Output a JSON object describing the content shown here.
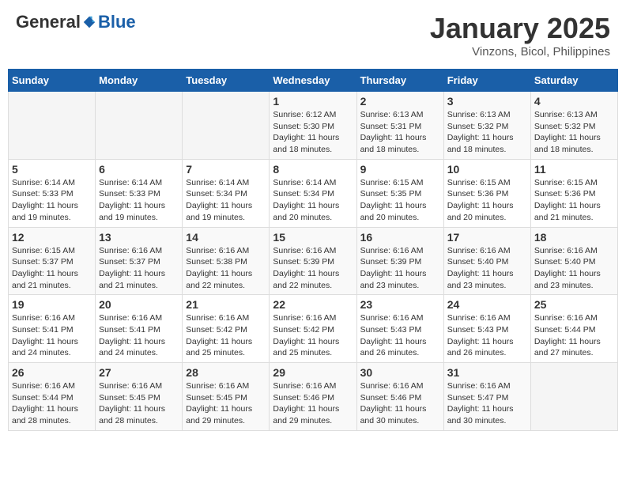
{
  "header": {
    "logo": {
      "general": "General",
      "blue": "Blue"
    },
    "title": "January 2025",
    "subtitle": "Vinzons, Bicol, Philippines"
  },
  "weekdays": [
    "Sunday",
    "Monday",
    "Tuesday",
    "Wednesday",
    "Thursday",
    "Friday",
    "Saturday"
  ],
  "weeks": [
    [
      {
        "day": "",
        "sunrise": "",
        "sunset": "",
        "daylight": "",
        "empty": true
      },
      {
        "day": "",
        "sunrise": "",
        "sunset": "",
        "daylight": "",
        "empty": true
      },
      {
        "day": "",
        "sunrise": "",
        "sunset": "",
        "daylight": "",
        "empty": true
      },
      {
        "day": "1",
        "sunrise": "Sunrise: 6:12 AM",
        "sunset": "Sunset: 5:30 PM",
        "daylight": "Daylight: 11 hours and 18 minutes.",
        "empty": false
      },
      {
        "day": "2",
        "sunrise": "Sunrise: 6:13 AM",
        "sunset": "Sunset: 5:31 PM",
        "daylight": "Daylight: 11 hours and 18 minutes.",
        "empty": false
      },
      {
        "day": "3",
        "sunrise": "Sunrise: 6:13 AM",
        "sunset": "Sunset: 5:32 PM",
        "daylight": "Daylight: 11 hours and 18 minutes.",
        "empty": false
      },
      {
        "day": "4",
        "sunrise": "Sunrise: 6:13 AM",
        "sunset": "Sunset: 5:32 PM",
        "daylight": "Daylight: 11 hours and 18 minutes.",
        "empty": false
      }
    ],
    [
      {
        "day": "5",
        "sunrise": "Sunrise: 6:14 AM",
        "sunset": "Sunset: 5:33 PM",
        "daylight": "Daylight: 11 hours and 19 minutes.",
        "empty": false
      },
      {
        "day": "6",
        "sunrise": "Sunrise: 6:14 AM",
        "sunset": "Sunset: 5:33 PM",
        "daylight": "Daylight: 11 hours and 19 minutes.",
        "empty": false
      },
      {
        "day": "7",
        "sunrise": "Sunrise: 6:14 AM",
        "sunset": "Sunset: 5:34 PM",
        "daylight": "Daylight: 11 hours and 19 minutes.",
        "empty": false
      },
      {
        "day": "8",
        "sunrise": "Sunrise: 6:14 AM",
        "sunset": "Sunset: 5:34 PM",
        "daylight": "Daylight: 11 hours and 20 minutes.",
        "empty": false
      },
      {
        "day": "9",
        "sunrise": "Sunrise: 6:15 AM",
        "sunset": "Sunset: 5:35 PM",
        "daylight": "Daylight: 11 hours and 20 minutes.",
        "empty": false
      },
      {
        "day": "10",
        "sunrise": "Sunrise: 6:15 AM",
        "sunset": "Sunset: 5:36 PM",
        "daylight": "Daylight: 11 hours and 20 minutes.",
        "empty": false
      },
      {
        "day": "11",
        "sunrise": "Sunrise: 6:15 AM",
        "sunset": "Sunset: 5:36 PM",
        "daylight": "Daylight: 11 hours and 21 minutes.",
        "empty": false
      }
    ],
    [
      {
        "day": "12",
        "sunrise": "Sunrise: 6:15 AM",
        "sunset": "Sunset: 5:37 PM",
        "daylight": "Daylight: 11 hours and 21 minutes.",
        "empty": false
      },
      {
        "day": "13",
        "sunrise": "Sunrise: 6:16 AM",
        "sunset": "Sunset: 5:37 PM",
        "daylight": "Daylight: 11 hours and 21 minutes.",
        "empty": false
      },
      {
        "day": "14",
        "sunrise": "Sunrise: 6:16 AM",
        "sunset": "Sunset: 5:38 PM",
        "daylight": "Daylight: 11 hours and 22 minutes.",
        "empty": false
      },
      {
        "day": "15",
        "sunrise": "Sunrise: 6:16 AM",
        "sunset": "Sunset: 5:39 PM",
        "daylight": "Daylight: 11 hours and 22 minutes.",
        "empty": false
      },
      {
        "day": "16",
        "sunrise": "Sunrise: 6:16 AM",
        "sunset": "Sunset: 5:39 PM",
        "daylight": "Daylight: 11 hours and 23 minutes.",
        "empty": false
      },
      {
        "day": "17",
        "sunrise": "Sunrise: 6:16 AM",
        "sunset": "Sunset: 5:40 PM",
        "daylight": "Daylight: 11 hours and 23 minutes.",
        "empty": false
      },
      {
        "day": "18",
        "sunrise": "Sunrise: 6:16 AM",
        "sunset": "Sunset: 5:40 PM",
        "daylight": "Daylight: 11 hours and 23 minutes.",
        "empty": false
      }
    ],
    [
      {
        "day": "19",
        "sunrise": "Sunrise: 6:16 AM",
        "sunset": "Sunset: 5:41 PM",
        "daylight": "Daylight: 11 hours and 24 minutes.",
        "empty": false
      },
      {
        "day": "20",
        "sunrise": "Sunrise: 6:16 AM",
        "sunset": "Sunset: 5:41 PM",
        "daylight": "Daylight: 11 hours and 24 minutes.",
        "empty": false
      },
      {
        "day": "21",
        "sunrise": "Sunrise: 6:16 AM",
        "sunset": "Sunset: 5:42 PM",
        "daylight": "Daylight: 11 hours and 25 minutes.",
        "empty": false
      },
      {
        "day": "22",
        "sunrise": "Sunrise: 6:16 AM",
        "sunset": "Sunset: 5:42 PM",
        "daylight": "Daylight: 11 hours and 25 minutes.",
        "empty": false
      },
      {
        "day": "23",
        "sunrise": "Sunrise: 6:16 AM",
        "sunset": "Sunset: 5:43 PM",
        "daylight": "Daylight: 11 hours and 26 minutes.",
        "empty": false
      },
      {
        "day": "24",
        "sunrise": "Sunrise: 6:16 AM",
        "sunset": "Sunset: 5:43 PM",
        "daylight": "Daylight: 11 hours and 26 minutes.",
        "empty": false
      },
      {
        "day": "25",
        "sunrise": "Sunrise: 6:16 AM",
        "sunset": "Sunset: 5:44 PM",
        "daylight": "Daylight: 11 hours and 27 minutes.",
        "empty": false
      }
    ],
    [
      {
        "day": "26",
        "sunrise": "Sunrise: 6:16 AM",
        "sunset": "Sunset: 5:44 PM",
        "daylight": "Daylight: 11 hours and 28 minutes.",
        "empty": false
      },
      {
        "day": "27",
        "sunrise": "Sunrise: 6:16 AM",
        "sunset": "Sunset: 5:45 PM",
        "daylight": "Daylight: 11 hours and 28 minutes.",
        "empty": false
      },
      {
        "day": "28",
        "sunrise": "Sunrise: 6:16 AM",
        "sunset": "Sunset: 5:45 PM",
        "daylight": "Daylight: 11 hours and 29 minutes.",
        "empty": false
      },
      {
        "day": "29",
        "sunrise": "Sunrise: 6:16 AM",
        "sunset": "Sunset: 5:46 PM",
        "daylight": "Daylight: 11 hours and 29 minutes.",
        "empty": false
      },
      {
        "day": "30",
        "sunrise": "Sunrise: 6:16 AM",
        "sunset": "Sunset: 5:46 PM",
        "daylight": "Daylight: 11 hours and 30 minutes.",
        "empty": false
      },
      {
        "day": "31",
        "sunrise": "Sunrise: 6:16 AM",
        "sunset": "Sunset: 5:47 PM",
        "daylight": "Daylight: 11 hours and 30 minutes.",
        "empty": false
      },
      {
        "day": "",
        "sunrise": "",
        "sunset": "",
        "daylight": "",
        "empty": true
      }
    ]
  ]
}
